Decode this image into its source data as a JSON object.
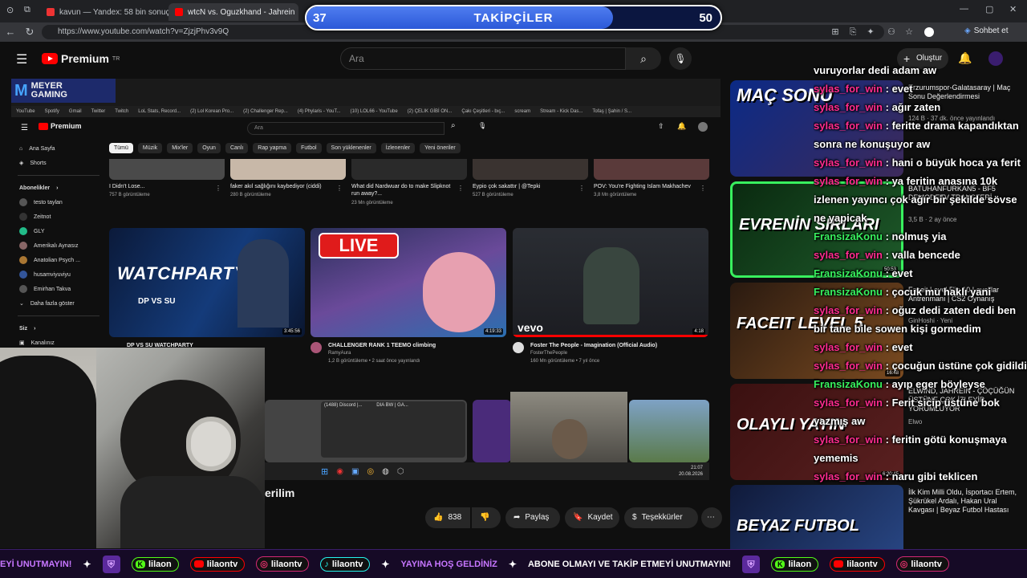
{
  "browser": {
    "tabs": [
      {
        "label": "kavun — Yandex: 58 bin sonuç bu"
      },
      {
        "label": "wtcN vs. Oguzkhand - Jahrein"
      }
    ],
    "url": "https://www.youtube.com/watch?v=ZjzjPhv3v9Q",
    "chat_button": "Sohbet et"
  },
  "overlay": {
    "follower_current": "37",
    "follower_title": "TAKİPÇİLER",
    "follower_goal": "50",
    "follower_progress": 0.74
  },
  "youtube": {
    "logo": "Premium",
    "logo_region": "TR",
    "search_placeholder": "Ara",
    "create_label": "Oluştur",
    "actions": {
      "likes": "838",
      "share": "Paylaş",
      "save": "Kaydet",
      "thanks": "Teşekkürler"
    },
    "title_fragment": "erilim"
  },
  "embedded": {
    "brand_line1": "MEYER",
    "brand_line2": "GAMING",
    "bookmarks": [
      "YouTube",
      "Spotify",
      "Gmail",
      "Twitter",
      "Twitch",
      "LoL Stats, Record...",
      "(2) Lol Korean Pro...",
      "(2) Challenger Rep...",
      "(4) Phylaris - YouT...",
      "(10) LOL66 - YouTube",
      "(2) ÇELIK GİBİ ON...",
      "Çakı Çeşitleri - bıç...",
      "scream",
      "Stream - Kick Das...",
      "Tofaş | Şahin / S..."
    ],
    "logo": "Premium",
    "search_placeholder": "Ara",
    "sidebar": {
      "home": "Ana Sayfa",
      "shorts": "Shorts",
      "subs_title": "Abonelikler",
      "subs": [
        "testo taylan",
        "Zeitnot",
        "GLY",
        "Amerikalı Aynasız",
        "Anatolian Psych ...",
        "husamviyuviyu",
        "Emirhan Takva"
      ],
      "more": "Daha fazla göster",
      "you": "Siz",
      "history": "Kanalınız"
    },
    "chips": [
      "Tümü",
      "Müzik",
      "Mix'ler",
      "Oyun",
      "Canlı",
      "Rap yapma",
      "Futbol",
      "Son yüklenenler",
      "İzlenenler",
      "Yeni öneriler"
    ],
    "row1": [
      {
        "title": "I Didn't Lose...",
        "meta": "757 B görüntüleme"
      },
      {
        "title": "faker akıl sağlığını kaybediyor (ciddi)",
        "meta": "280 B görüntüleme"
      },
      {
        "title": "What did Nardwuar do to make Slipknot run away?...",
        "meta": "23 Mn görüntüleme"
      },
      {
        "title": "Eypio çok sakattır | @Tepki",
        "meta": "527 B görüntüleme"
      },
      {
        "title": "POV: You're Fighting Islam Makhachev",
        "meta": "3,8 Mn görüntüleme"
      }
    ],
    "row2": [
      {
        "thumb": "WATCHPARTY",
        "sub": "DP VS SU",
        "title": "DP VS SU WATCHPARTY",
        "dur": "3:45:56",
        "channel": "",
        "meta": ""
      },
      {
        "thumb": "LIVE",
        "title": "CHALLENGER RANK 1 TEEMO climbing",
        "dur": "4:19:33",
        "channel": "RamyAura",
        "meta": "1,2 B görüntüleme • 2 saat önce yayınlandı"
      },
      {
        "thumb": "vevo",
        "title": "Foster The People - Imagination (Official Audio)",
        "dur": "4:18",
        "channel": "FosterThePeople",
        "meta": "160 Mn görüntüleme • 7 yıl önce"
      }
    ],
    "taskbar_windows": [
      "(1488) Discord |...",
      "DIA  BW | GA..."
    ],
    "clock": "21:07",
    "date": "20.08.2026"
  },
  "right_list": [
    {
      "thumb": "MAÇ SONU",
      "title": "Erzurumspor-Galatasaray | Maç Sonu Değerlendirmesi",
      "meta": "124 B · 37 dk. önce yayınlandı"
    },
    {
      "thumb": "EVRENİN SIRLARI",
      "title": "BATUHANFURKAN5 - BF5 DEMODETV TRANSFERİ",
      "meta": "3,5 B · 2 ay önce",
      "dur": "50:53"
    },
    {
      "thumb": "FACEIT LEVEL 5",
      "title": "Faceit Level 5'in 10 Level'lar Antrenmanı | CS2 Oynanış",
      "meta": "GinHoshi · Yeni",
      "dur": "16:48"
    },
    {
      "thumb": "OLAYLI YAYIN",
      "title": "ELWIND, JAHREIN - ÇÖÇÜĞÜN ÜSTÜNE ÇOK İZLEYİP YORUMLUYOR",
      "meta": "Elwo",
      "dur": "6:20:45"
    },
    {
      "thumb": "BEYAZ FUTBOL",
      "title": "İlk Kim Milli Oldu, İsportacı Ertem, Şükrükel Ardalı, Hakan Ural Kavgası | Beyaz Futbol Hastası",
      "meta": ""
    }
  ],
  "chat": [
    {
      "user": "",
      "text": "vuruyorlar dedi adam aw"
    },
    {
      "user": "sylas_for_win",
      "color": "pink",
      "text": "evet"
    },
    {
      "user": "sylas_for_win",
      "color": "pink",
      "text": "ağır zaten"
    },
    {
      "user": "sylas_for_win",
      "color": "pink",
      "text": "feritte drama kapandıktan sonra ne konuşuyor aw"
    },
    {
      "user": "sylas_for_win",
      "color": "pink",
      "text": "hani o büyük hoca ya ferit"
    },
    {
      "user": "sylas_for_win",
      "color": "pink",
      "text": "ya feritin anasına 10k izlenen yayıncı çok ağır bir şekilde sövse ne yapicak"
    },
    {
      "user": "FransizaKonu",
      "color": "green",
      "text": "nolmuş yia"
    },
    {
      "user": "sylas_for_win",
      "color": "pink",
      "text": "valla bencede"
    },
    {
      "user": "FransizaKonu",
      "color": "green",
      "text": "evet"
    },
    {
      "user": "FransizaKonu",
      "color": "green",
      "text": "çocuk mu haklı yani"
    },
    {
      "user": "sylas_for_win",
      "color": "pink",
      "text": "oğuz dedi zaten dedi ben bir tane bile sowen kişi gormedim"
    },
    {
      "user": "sylas_for_win",
      "color": "pink",
      "text": "evet"
    },
    {
      "user": "sylas_for_win",
      "color": "pink",
      "text": "çocuğun üstüne çok gidildi"
    },
    {
      "user": "FransizaKonu",
      "color": "green",
      "text": "ayıp eger böyleyse"
    },
    {
      "user": "sylas_for_win",
      "color": "pink",
      "text": "Ferit sicip üstüne bok yazmış aw"
    },
    {
      "user": "sylas_for_win",
      "color": "pink",
      "text": "feritin götü konuşmaya yememis"
    },
    {
      "user": "sylas_for_win",
      "color": "pink",
      "text": "naru gibi teklicen"
    }
  ],
  "ticker": {
    "msg1": "EYİ UNUTMAYIN!",
    "kick": "lilaon",
    "youtube": "lilaontv",
    "instagram": "lilaontv",
    "tiktok": "lilaontv",
    "welcome": "YAYINA HOŞ GELDİNİZ",
    "msg2": "ABONE OLMAYI VE TAKİP ETMEYİ UNUTMAYIN!",
    "kick2": "lilaon",
    "youtube2": "lilaontv",
    "instagram2": "lilaontv"
  }
}
